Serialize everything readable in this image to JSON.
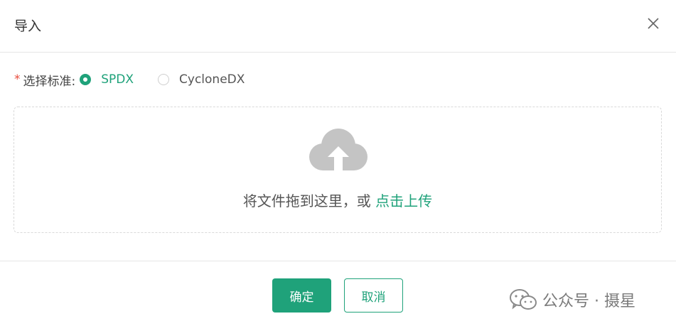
{
  "dialog": {
    "title": "导入",
    "close_icon": "close-icon"
  },
  "standard": {
    "required_mark": "*",
    "label": "选择标准:",
    "options": [
      {
        "label": "SPDX",
        "checked": true
      },
      {
        "label": "CycloneDX",
        "checked": false
      }
    ]
  },
  "upload": {
    "icon": "cloud-upload-icon",
    "hint": "将文件拖到这里，或 ",
    "link": "点击上传"
  },
  "footer": {
    "confirm_label": "确定",
    "cancel_label": "取消"
  },
  "watermark": {
    "icon": "wechat-icon",
    "text": "公众号 · 摄星"
  },
  "colors": {
    "accent": "#1fa27a",
    "required": "#e84c3d"
  }
}
